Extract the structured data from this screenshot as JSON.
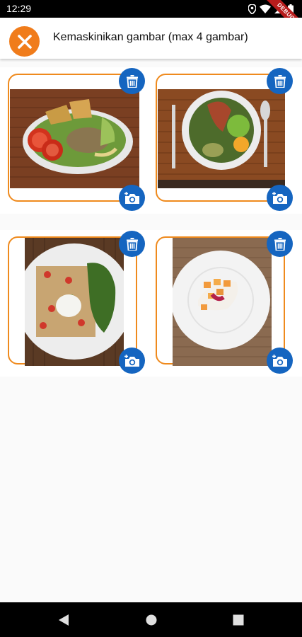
{
  "status_bar": {
    "time": "12:29",
    "icons": [
      "location-icon",
      "wifi-icon",
      "signal-icon",
      "battery-icon"
    ],
    "debug_banner": "DEBUG"
  },
  "app_bar": {
    "close_icon": "close-icon",
    "title": "Kemaskinikan gambar (max 4 gambar)",
    "accent_color": "#f07c1b"
  },
  "images": [
    {
      "slot": 1,
      "subject": "salad-with-tomato-and-chicken",
      "actions": [
        "delete-icon",
        "camera-icon"
      ]
    },
    {
      "slot": 2,
      "subject": "bowl-with-salmon-and-peas",
      "actions": [
        "delete-icon",
        "camera-icon"
      ]
    },
    {
      "slot": 3,
      "subject": "plate-with-salad-and-egg",
      "actions": [
        "delete-icon",
        "camera-icon"
      ]
    },
    {
      "slot": 4,
      "subject": "plate-with-fruit-dessert",
      "actions": [
        "delete-icon",
        "camera-icon"
      ]
    }
  ],
  "colors": {
    "card_border": "#ef8a1d",
    "action_button": "#1565c0"
  },
  "nav_bar": {
    "icons": [
      "back-icon",
      "home-icon",
      "recents-icon"
    ]
  }
}
